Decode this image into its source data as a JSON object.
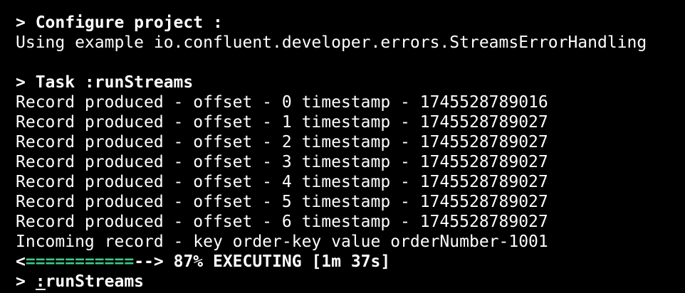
{
  "configure": {
    "header": "> Configure project :",
    "using": "Using example io.confluent.developer.errors.StreamsErrorHandling"
  },
  "task": {
    "header": "> Task :runStreams"
  },
  "records": [
    "Record produced - offset - 0 timestamp - 1745528789016",
    "Record produced - offset - 1 timestamp - 1745528789027",
    "Record produced - offset - 2 timestamp - 1745528789027",
    "Record produced - offset - 3 timestamp - 1745528789027",
    "Record produced - offset - 4 timestamp - 1745528789027",
    "Record produced - offset - 5 timestamp - 1745528789027",
    "Record produced - offset - 6 timestamp - 1745528789027"
  ],
  "incoming": "Incoming record - key order-key value orderNumber-1001",
  "progress": {
    "open": "<",
    "filled": "===========",
    "empty": "--",
    "close": ">",
    "status": " 87% EXECUTING [1m 37s]",
    "percent": 87,
    "filled_color": "#3fc98a"
  },
  "prompt": {
    "prefix": "> ",
    "cursor_char": ":",
    "rest": "runStreams"
  }
}
